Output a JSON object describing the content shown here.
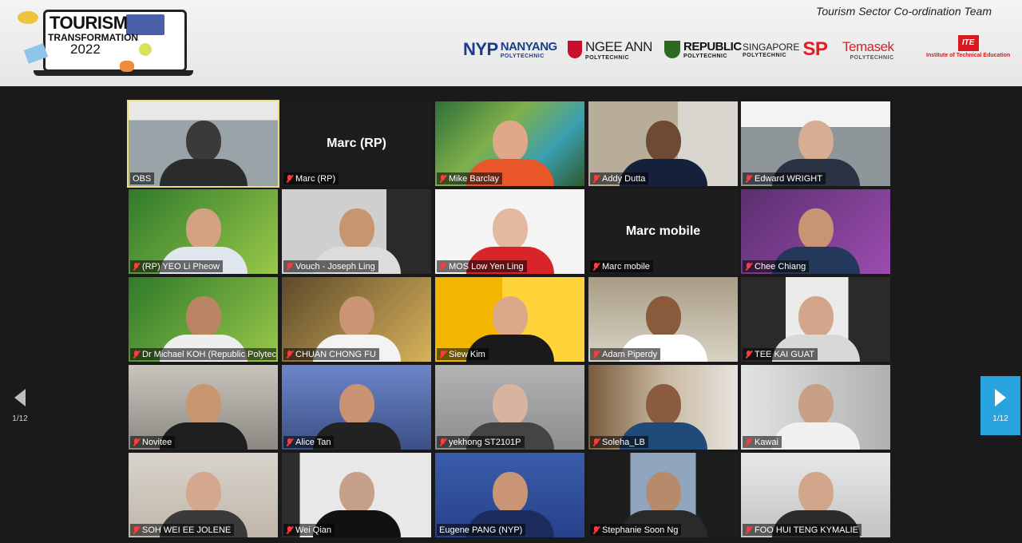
{
  "banner": {
    "event_title": "TOURISM",
    "event_subtitle": "TRANSFORMATION",
    "event_year": "2022",
    "team": "Tourism Sector Co-ordination Team",
    "logos": [
      {
        "abbr": "NYP",
        "name": "NANYANG",
        "sub": "POLYTECHNIC"
      },
      {
        "name": "NGEE ANN",
        "sub": "POLYTECHNIC"
      },
      {
        "name": "REPUBLIC",
        "sub": "POLYTECHNIC"
      },
      {
        "name": "SINGAPORE",
        "sub": "POLYTECHNIC",
        "abbr": "SP"
      },
      {
        "name": "Temasek",
        "sub": "POLYTECHNIC"
      },
      {
        "abbr": "ITE",
        "name": "Institute of Technical Education"
      }
    ]
  },
  "pager": {
    "current": "1/12"
  },
  "participants": [
    {
      "name": "OBS",
      "muted": false
    },
    {
      "name": "Marc (RP)",
      "muted": true,
      "video": false
    },
    {
      "name": "Mike Barclay",
      "muted": true
    },
    {
      "name": "Addy Dutta",
      "muted": true
    },
    {
      "name": "Edward WRIGHT",
      "muted": true
    },
    {
      "name": "(RP) YEO Li Pheow",
      "muted": true
    },
    {
      "name": "Vouch - Joseph Ling",
      "muted": true
    },
    {
      "name": "MOS Low Yen Ling",
      "muted": true
    },
    {
      "name": "Marc mobile",
      "muted": true,
      "video": false
    },
    {
      "name": "Chee Chiang",
      "muted": true
    },
    {
      "name": "Dr Michael KOH (Republic Polytec...",
      "muted": true
    },
    {
      "name": "CHUAN CHONG FU",
      "muted": true
    },
    {
      "name": "Siew Kim",
      "muted": true
    },
    {
      "name": "Adam Piperdy",
      "muted": true
    },
    {
      "name": "TEE KAI GUAT",
      "muted": true
    },
    {
      "name": "Novitee",
      "muted": true
    },
    {
      "name": "Alice Tan",
      "muted": true
    },
    {
      "name": "yekhong ST2101P",
      "muted": true
    },
    {
      "name": "Soleha_LB",
      "muted": true
    },
    {
      "name": "Kawai",
      "muted": true
    },
    {
      "name": "SOH WEI EE JOLENE",
      "muted": true
    },
    {
      "name": "Wei Qian",
      "muted": true
    },
    {
      "name": "Eugene PANG (NYP)",
      "muted": false
    },
    {
      "name": "Stephanie Soon Ng",
      "muted": true
    },
    {
      "name": "FOO HUI TENG KYMALIE",
      "muted": true
    }
  ],
  "colors": {
    "accent": "#27a3dd",
    "active_border": "#e4e07a",
    "muted_mic": "#ff3b3b"
  }
}
